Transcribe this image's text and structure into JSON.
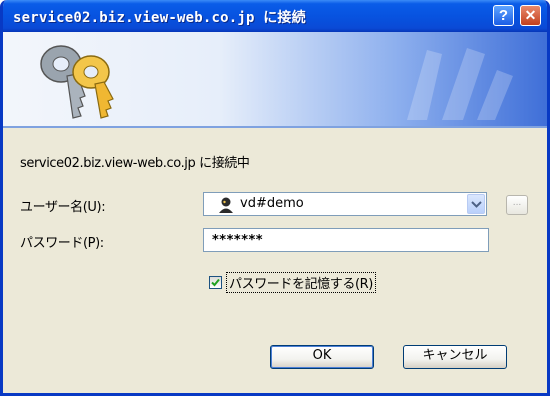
{
  "window": {
    "title": "service02.biz.view-web.co.jp に接続"
  },
  "titlebar": {
    "help_glyph": "?",
    "close_glyph": "✕"
  },
  "icons": {
    "banner": "keys-icon",
    "user": "user-icon",
    "dropdown": "chevron-down-icon",
    "check": "checkmark-icon"
  },
  "message": "service02.biz.view-web.co.jp に接続中",
  "form": {
    "user_label": "ユーザー名(U):",
    "user_value": "vd#demo",
    "browse_label": "...",
    "password_label": "パスワード(P):",
    "password_value": "*******",
    "remember_label": "パスワードを記憶する(R)",
    "remember_checked": true
  },
  "buttons": {
    "ok": "OK",
    "cancel": "キャンセル"
  },
  "colors": {
    "titlebar": "#0a5ce8",
    "frame": "#0839c4",
    "dialog_bg": "#ece9d8"
  }
}
